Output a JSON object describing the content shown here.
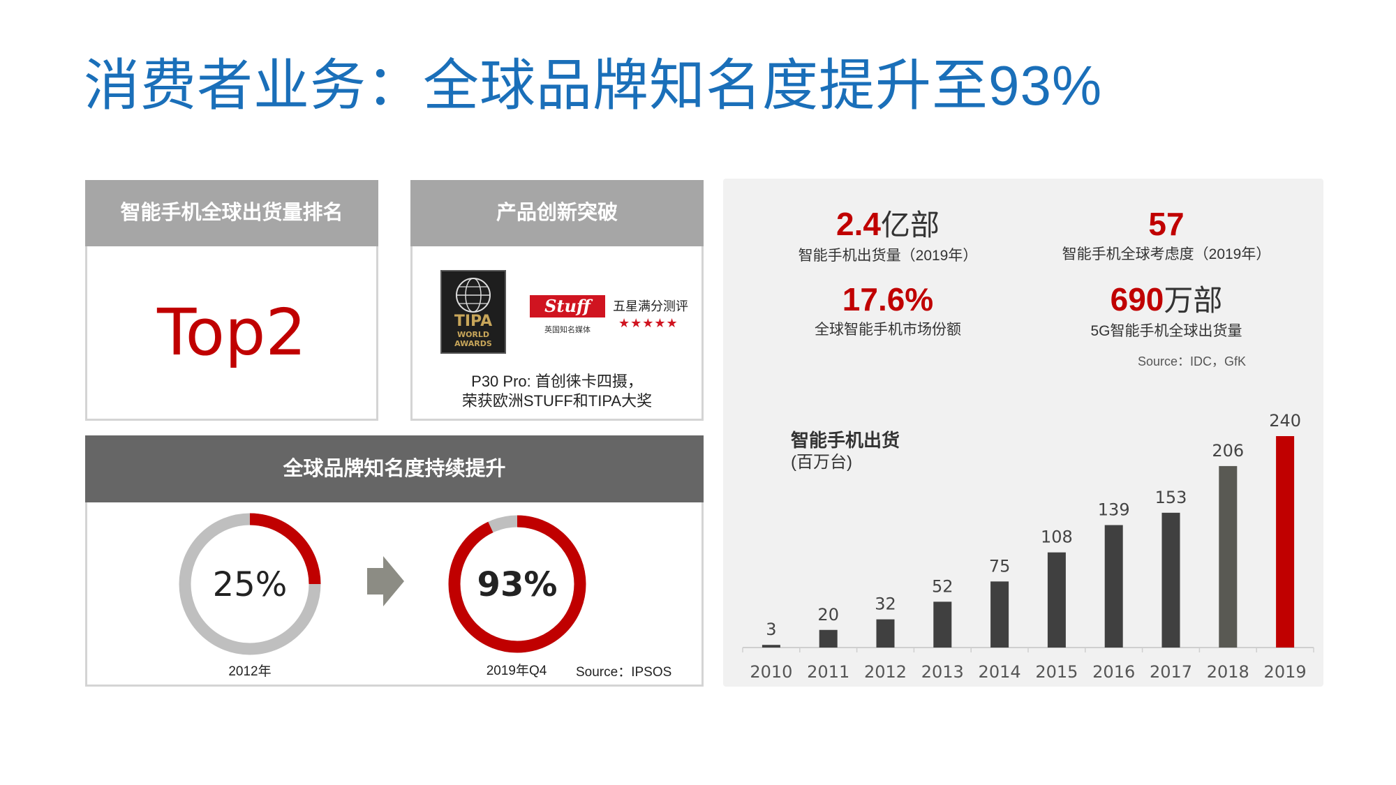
{
  "title": "消费者业务：全球品牌知名度提升至93%",
  "rank_card": {
    "header": "智能手机全球出货量排名",
    "value": "Top2"
  },
  "innovation_card": {
    "header": "产品创新突破",
    "stuff_logo_text": "Stuff",
    "stuff_sub": "英国知名媒体",
    "stuff_rating_label": "五星满分测评",
    "stars": "★★★★★",
    "line1": "P30 Pro: 首创徕卡四摄，",
    "line2": "荣获欧洲STUFF和TIPA大奖"
  },
  "brand_card": {
    "header": "全球品牌知名度持续提升",
    "before": {
      "value": "25%",
      "fraction": 0.25,
      "label": "2012年"
    },
    "after": {
      "value": "93%",
      "fraction": 0.93,
      "label": "2019年Q4"
    },
    "source": "Source：IPSOS"
  },
  "stats": [
    {
      "num": "2.4",
      "unit": "亿部",
      "label": "智能手机出货量（2019年）"
    },
    {
      "num": "57",
      "unit": "",
      "label": "智能手机全球考虑度（2019年）"
    },
    {
      "num": "17.6%",
      "unit": "",
      "label": "全球智能手机市场份额"
    },
    {
      "num": "690",
      "unit": "万部",
      "label": "5G智能手机全球出货量"
    }
  ],
  "stats_source": "Source：IDC，GfK",
  "chart_data": {
    "type": "bar",
    "title": "智能手机出货",
    "unit_label": "(百万台)",
    "categories": [
      "2010",
      "2011",
      "2012",
      "2013",
      "2014",
      "2015",
      "2016",
      "2017",
      "2018",
      "2019"
    ],
    "values": [
      3,
      20,
      32,
      52,
      75,
      108,
      139,
      153,
      206,
      240
    ],
    "ylim": [
      0,
      240
    ],
    "grid": false,
    "colors": [
      "#404040",
      "#404040",
      "#404040",
      "#404040",
      "#404040",
      "#404040",
      "#404040",
      "#404040",
      "#595953",
      "#c00000"
    ]
  },
  "colors": {
    "title_blue": "#1a6fb9",
    "accent_red": "#c00000",
    "ring_gray": "#bfbfbf",
    "header_gray": "#a6a6a6",
    "header_dark": "#666666"
  }
}
